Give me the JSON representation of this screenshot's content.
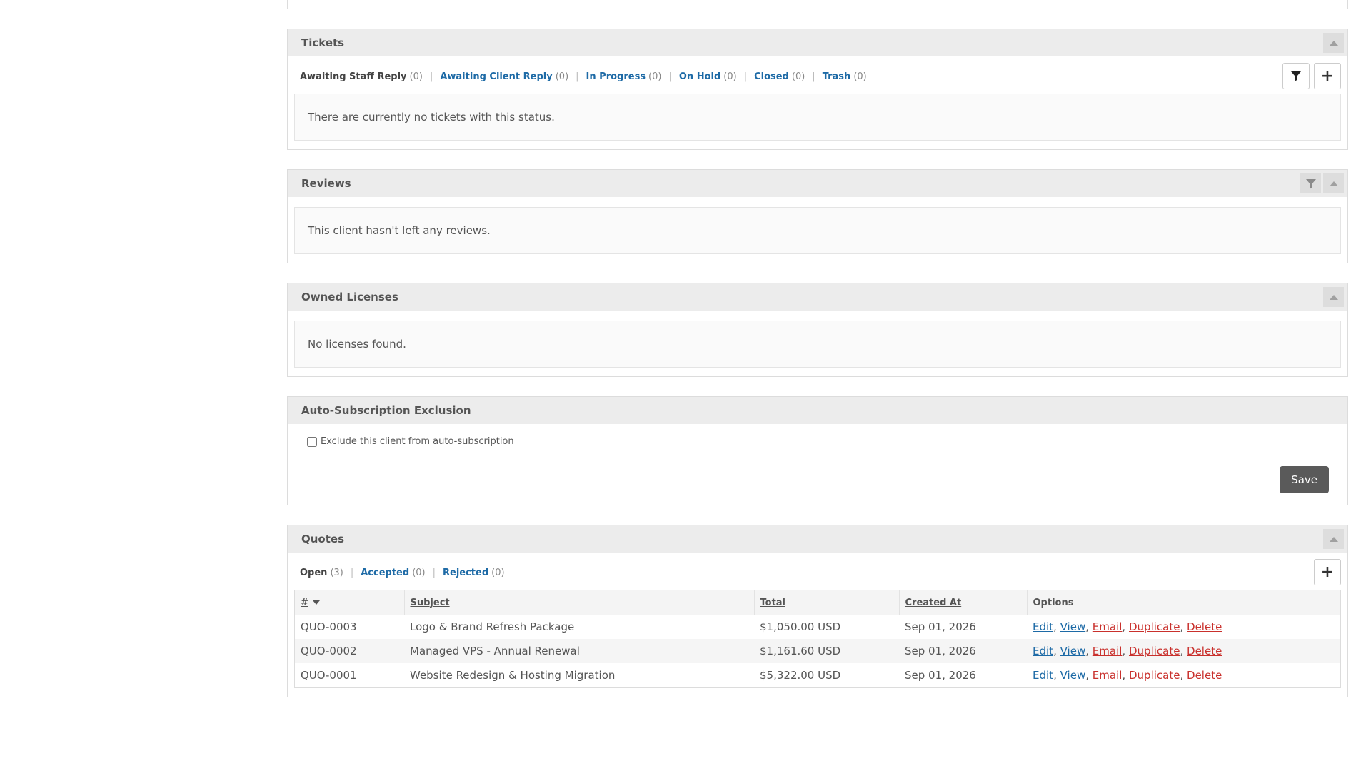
{
  "tickets": {
    "title": "Tickets",
    "statuses": [
      {
        "label": "Awaiting Staff Reply",
        "count": "(0)"
      },
      {
        "label": "Awaiting Client Reply",
        "count": "(0)"
      },
      {
        "label": "In Progress",
        "count": "(0)"
      },
      {
        "label": "On Hold",
        "count": "(0)"
      },
      {
        "label": "Closed",
        "count": "(0)"
      },
      {
        "label": "Trash",
        "count": "(0)"
      }
    ],
    "empty": "There are currently no tickets with this status."
  },
  "reviews": {
    "title": "Reviews",
    "empty": "This client hasn't left any reviews."
  },
  "licenses": {
    "title": "Owned Licenses",
    "empty": "No licenses found."
  },
  "autosub": {
    "title": "Auto-Subscription Exclusion",
    "checkbox_label": "Exclude this client from auto-subscription",
    "save_label": "Save"
  },
  "quotes": {
    "title": "Quotes",
    "statuses": [
      {
        "label": "Open",
        "count": "(3)"
      },
      {
        "label": "Accepted",
        "count": "(0)"
      },
      {
        "label": "Rejected",
        "count": "(0)"
      }
    ],
    "columns": [
      "#",
      "Subject",
      "Total",
      "Created At",
      "Options"
    ],
    "rows": [
      {
        "id": "QUO-0003",
        "subject": "Logo & Brand Refresh Package",
        "total": "$1,050.00 USD",
        "created": "Sep 01, 2026"
      },
      {
        "id": "QUO-0002",
        "subject": "Managed VPS - Annual Renewal",
        "total": "$1,161.60 USD",
        "created": "Sep 01, 2026"
      },
      {
        "id": "QUO-0001",
        "subject": "Website Redesign & Hosting Migration",
        "total": "$5,322.00 USD",
        "created": "Sep 01, 2026"
      }
    ],
    "options": {
      "edit": "Edit",
      "view": "View",
      "email": "Email",
      "duplicate": "Duplicate",
      "delete": "Delete"
    },
    "separator": ","
  },
  "icons": {
    "filter": "filter-icon",
    "collapse": "caret-up-icon",
    "add": "plus-icon",
    "sort": "caret-down-icon"
  },
  "colors": {
    "link": "#1d6aa6",
    "danger": "#c9302c",
    "header_bg": "#ececec",
    "save_bg": "#5a5a5a"
  }
}
